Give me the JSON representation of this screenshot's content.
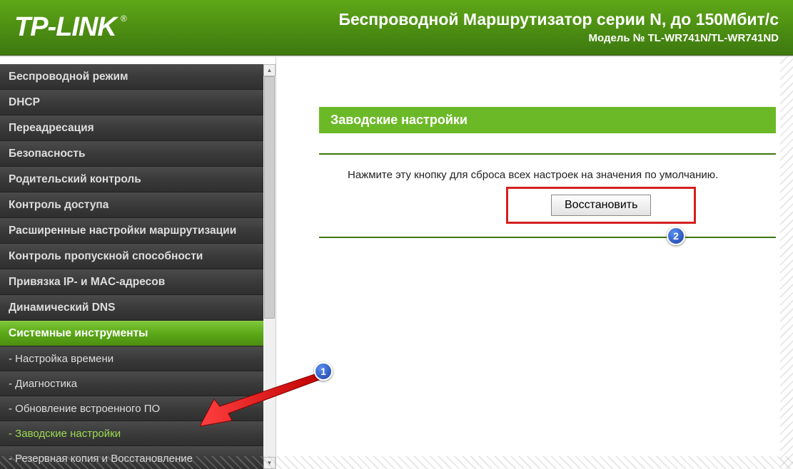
{
  "header": {
    "logo": "TP-LINK",
    "title": "Беспроводной Маршрутизатор серии N, до 150Мбит/с",
    "model": "Модель № TL-WR741N/TL-WR741ND"
  },
  "sidebar": {
    "items": [
      {
        "label": "Беспроводной режим",
        "type": "main"
      },
      {
        "label": "DHCP",
        "type": "main"
      },
      {
        "label": "Переадресация",
        "type": "main"
      },
      {
        "label": "Безопасность",
        "type": "main"
      },
      {
        "label": "Родительский контроль",
        "type": "main"
      },
      {
        "label": "Контроль доступа",
        "type": "main"
      },
      {
        "label": "Расширенные настройки маршрутизации",
        "type": "main"
      },
      {
        "label": "Контроль пропускной способности",
        "type": "main"
      },
      {
        "label": "Привязка IP- и MAC-адресов",
        "type": "main"
      },
      {
        "label": "Динамический DNS",
        "type": "main"
      },
      {
        "label": "Системные инструменты",
        "type": "expanded"
      },
      {
        "label": "- Настройка времени",
        "type": "sub"
      },
      {
        "label": "- Диагностика",
        "type": "sub"
      },
      {
        "label": "- Обновление встроенного ПО",
        "type": "sub"
      },
      {
        "label": "- Заводские настройки",
        "type": "sub active"
      },
      {
        "label": "- Резервная копия и Восстановление",
        "type": "sub"
      }
    ]
  },
  "content": {
    "panel_title": "Заводские настройки",
    "instruction": "Нажмите эту кнопку для сброса всех настроек на значения по умолчанию.",
    "restore_button": "Восстановить"
  },
  "callouts": {
    "c1": "1",
    "c2": "2"
  }
}
